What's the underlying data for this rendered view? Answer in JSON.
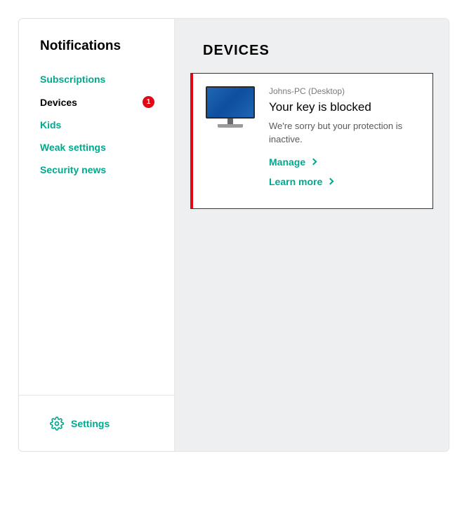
{
  "sidebar": {
    "title": "Notifications",
    "items": [
      {
        "label": "Subscriptions",
        "active": false,
        "badge": null
      },
      {
        "label": "Devices",
        "active": true,
        "badge": "1"
      },
      {
        "label": "Kids",
        "active": false,
        "badge": null
      },
      {
        "label": "Weak settings",
        "active": false,
        "badge": null
      },
      {
        "label": "Security news",
        "active": false,
        "badge": null
      }
    ],
    "settings_label": "Settings"
  },
  "main": {
    "title": "DEVICES",
    "card": {
      "device_name": "Johns-PC (Desktop)",
      "title": "Your key is blocked",
      "description": "We're sorry but your protection is inactive.",
      "actions": [
        {
          "label": "Manage"
        },
        {
          "label": "Learn more"
        }
      ]
    }
  }
}
